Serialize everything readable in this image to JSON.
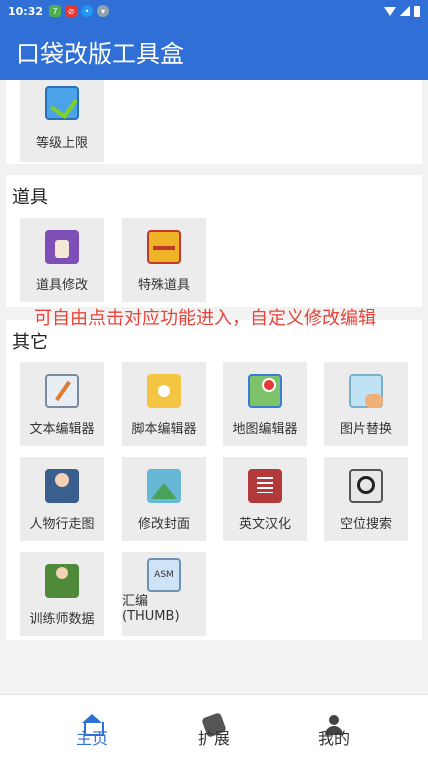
{
  "status_bar": {
    "time": "10:32"
  },
  "app_bar": {
    "title": "口袋改版工具盒"
  },
  "sections": {
    "level": {
      "items": [
        {
          "label": "等级上限",
          "icon": "level-cap-icon"
        }
      ]
    },
    "items": {
      "title": "道具",
      "items": [
        {
          "label": "道具修改",
          "icon": "item-bottle-icon"
        },
        {
          "label": "特殊道具",
          "icon": "treasure-chest-icon"
        }
      ]
    },
    "other": {
      "title": "其它",
      "items": [
        {
          "label": "文本编辑器",
          "icon": "text-editor-icon"
        },
        {
          "label": "脚本编辑器",
          "icon": "script-gear-icon"
        },
        {
          "label": "地图编辑器",
          "icon": "map-icon"
        },
        {
          "label": "图片替换",
          "icon": "picture-icon"
        },
        {
          "label": "人物行走图",
          "icon": "character-sprite-icon"
        },
        {
          "label": "修改封面",
          "icon": "cover-icon"
        },
        {
          "label": "英文汉化",
          "icon": "translate-list-icon"
        },
        {
          "label": "空位搜索",
          "icon": "magnifier-icon"
        },
        {
          "label": "训练师数据",
          "icon": "trainer-icon"
        },
        {
          "label": "汇编\n(THUMB)",
          "icon": "asm-icon",
          "icon_text": "ASM"
        }
      ]
    }
  },
  "overlay_hint": "可自由点击对应功能进入，自定义修改编辑",
  "bottom_nav": {
    "items": [
      {
        "label": "主页",
        "active": true,
        "icon": "home-icon"
      },
      {
        "label": "扩展",
        "active": false,
        "icon": "extension-icon"
      },
      {
        "label": "我的",
        "active": false,
        "icon": "profile-icon"
      }
    ]
  },
  "colors": {
    "primary": "#2f6fd6",
    "hint_red": "#e8443a"
  }
}
